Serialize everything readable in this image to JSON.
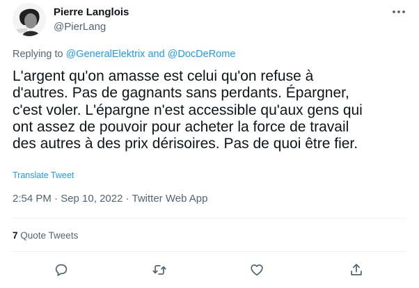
{
  "author": {
    "name": "Pierre Langlois",
    "handle": "@PierLang"
  },
  "reply": {
    "prefix": "Replying to ",
    "user1": "@GeneralElektrix",
    "joiner": " and ",
    "user2": "@DocDeRome"
  },
  "tweet": {
    "lines": [
      "L'argent qu'on amasse est celui qu'on refuse à",
      "d'autres. Pas de gagnants sans perdants. Épargner,",
      "c'est voler. L'épargne n'est accessible qu'aux gens qui",
      "ont assez de pouvoir pour acheter la force de travail",
      "des autres à des prix dérisoires. Pas de quoi être fier."
    ],
    "translate_label": "Translate Tweet",
    "meta": "2:54 PM · Sep 10, 2022 · Twitter Web App"
  },
  "stats": {
    "quote_count": "7",
    "quote_label": " Quote Tweets"
  },
  "actions": [
    "reply-icon",
    "retweet-icon",
    "like-icon",
    "share-icon"
  ],
  "colors": {
    "link": "#1d9bf0",
    "secondary_text": "#536471",
    "primary_text": "#0f1419",
    "divider": "#eff3f4"
  }
}
